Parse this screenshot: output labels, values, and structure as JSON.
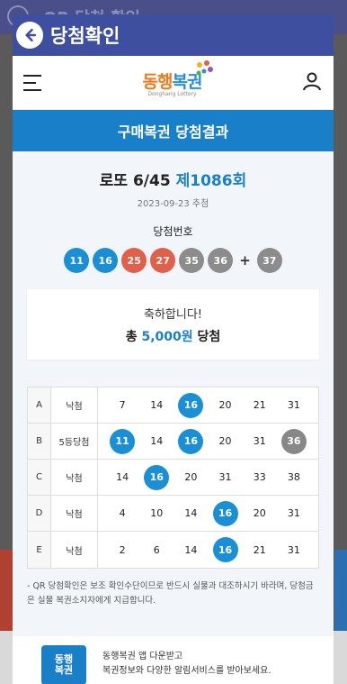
{
  "background": {
    "title": "QR 당첨 확인"
  },
  "modal": {
    "title": "당첨확인",
    "back_icon": "arrow-left-icon"
  },
  "app_header": {
    "menu_icon": "hamburger-icon",
    "logo_text_main": "동행",
    "logo_text_accent": "복권",
    "logo_sub": "Donghang Lottery",
    "user_icon": "user-icon"
  },
  "section": {
    "title": "구매복권 당첨결과"
  },
  "draw": {
    "game": "로또 6/45",
    "round": "제1086회",
    "date": "2023-09-23 추첨",
    "numbers_label": "당첨번호",
    "numbers": [
      {
        "value": "11",
        "color": "#1a8fd6"
      },
      {
        "value": "16",
        "color": "#1a8fd6"
      },
      {
        "value": "25",
        "color": "#e0604a"
      },
      {
        "value": "27",
        "color": "#e0604a"
      },
      {
        "value": "35",
        "color": "#8c8c8c"
      },
      {
        "value": "36",
        "color": "#8c8c8c"
      }
    ],
    "plus": "+",
    "bonus": {
      "value": "37",
      "color": "#8c8c8c"
    }
  },
  "result": {
    "congrats": "축하합니다!",
    "prize_prefix": "총 ",
    "prize_amount": "5,000원",
    "prize_suffix": " 당첨"
  },
  "ticket": {
    "rows": [
      {
        "line": "A",
        "result": "낙첨",
        "nums": [
          [
            "7",
            ""
          ],
          [
            "14",
            ""
          ],
          [
            "16",
            "hit"
          ],
          [
            "20",
            ""
          ],
          [
            "21",
            ""
          ],
          [
            "31",
            ""
          ]
        ]
      },
      {
        "line": "B",
        "result": "5등당첨",
        "nums": [
          [
            "11",
            "hit"
          ],
          [
            "14",
            ""
          ],
          [
            "16",
            "hit"
          ],
          [
            "20",
            ""
          ],
          [
            "31",
            ""
          ],
          [
            "36",
            "bonus"
          ]
        ]
      },
      {
        "line": "C",
        "result": "낙첨",
        "nums": [
          [
            "14",
            ""
          ],
          [
            "16",
            "hit"
          ],
          [
            "20",
            ""
          ],
          [
            "31",
            ""
          ],
          [
            "33",
            ""
          ],
          [
            "38",
            ""
          ]
        ]
      },
      {
        "line": "D",
        "result": "낙첨",
        "nums": [
          [
            "4",
            ""
          ],
          [
            "10",
            ""
          ],
          [
            "14",
            ""
          ],
          [
            "16",
            "hit"
          ],
          [
            "20",
            ""
          ],
          [
            "31",
            ""
          ]
        ]
      },
      {
        "line": "E",
        "result": "낙첨",
        "nums": [
          [
            "2",
            ""
          ],
          [
            "6",
            ""
          ],
          [
            "14",
            ""
          ],
          [
            "16",
            "hit"
          ],
          [
            "21",
            ""
          ],
          [
            "31",
            ""
          ]
        ]
      }
    ]
  },
  "notice": "- QR 당첨확인은 보조 확인수단이므로 반드시 실물과 대조하시기 바라며, 당첨금은 실물 복권소지자에게 지급합니다.",
  "app_banner": {
    "icon_text": "동행\n복권",
    "line1": "동행복권 앱 다운받고",
    "line2": "복권정보와 다양한 알림서비스를 받아보세요."
  }
}
